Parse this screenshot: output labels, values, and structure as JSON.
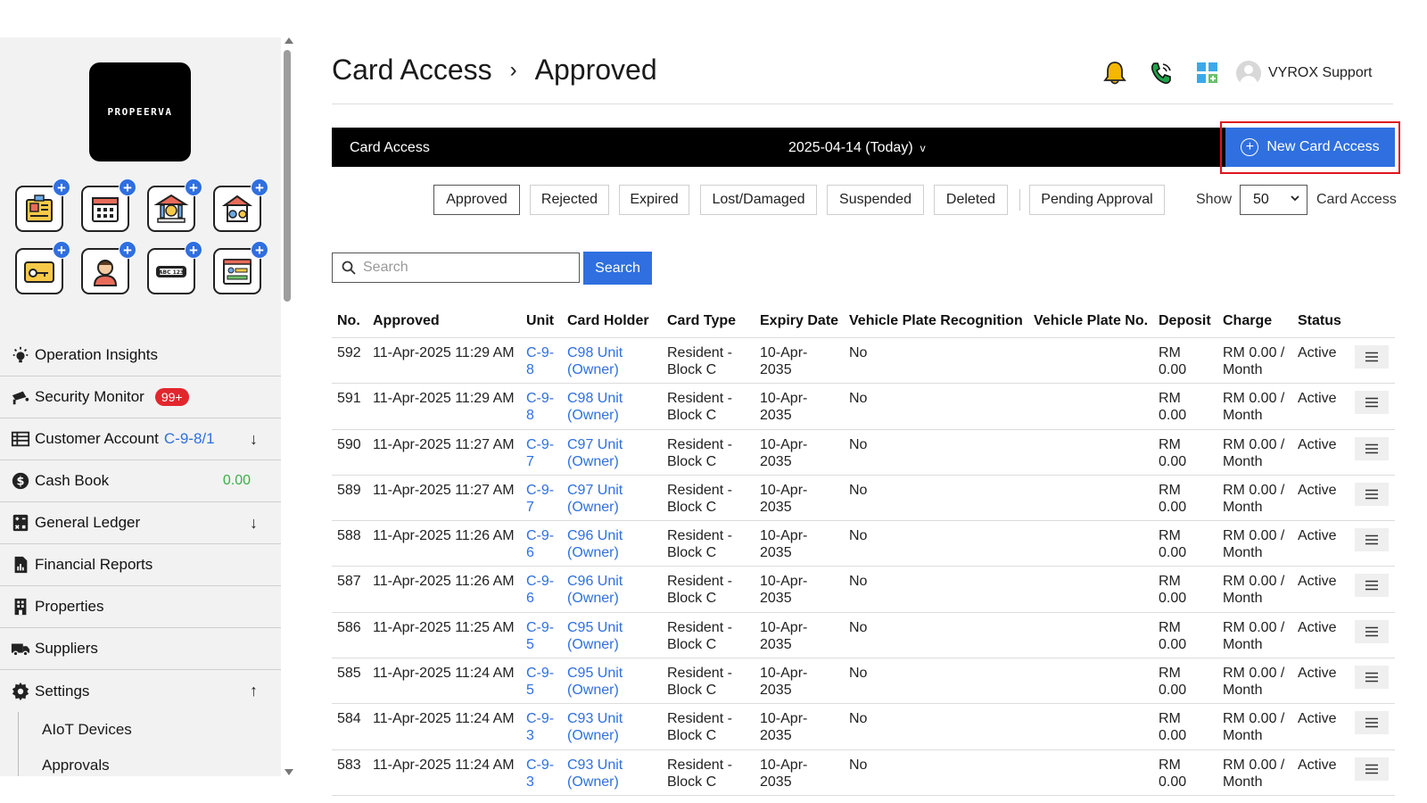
{
  "sidebar": {
    "logo_text": "PROPEERVA",
    "quick_actions": [
      {
        "icon": "resident-card-icon"
      },
      {
        "icon": "calendar-icon"
      },
      {
        "icon": "bank-icon"
      },
      {
        "icon": "facility-icon"
      },
      {
        "icon": "access-card-icon"
      },
      {
        "icon": "visitor-icon"
      },
      {
        "icon": "plate-number-icon"
      },
      {
        "icon": "login-screen-icon"
      }
    ],
    "nav": [
      {
        "label": "Operation Insights",
        "icon": "lightbulb-icon"
      },
      {
        "label": "Security Monitor",
        "icon": "security-camera-icon",
        "badge": "99+"
      },
      {
        "label": "Customer Account",
        "icon": "ledger-icon",
        "link": "C-9-8/1",
        "arrow": "↓"
      },
      {
        "label": "Cash Book",
        "icon": "dollar-icon",
        "value": "0.00"
      },
      {
        "label": "General Ledger",
        "icon": "calculator-icon",
        "arrow": "↓"
      },
      {
        "label": "Financial Reports",
        "icon": "report-icon"
      },
      {
        "label": "Properties",
        "icon": "building-icon"
      },
      {
        "label": "Suppliers",
        "icon": "truck-icon"
      },
      {
        "label": "Settings",
        "icon": "gear-icon",
        "arrow": "↑"
      }
    ],
    "sub_items": [
      "AIoT Devices",
      "Approvals"
    ]
  },
  "header": {
    "breadcrumb": [
      "Card Access",
      "Approved"
    ],
    "separator": "›",
    "user": "VYROX Support"
  },
  "toolbar": {
    "title": "Card Access",
    "date": "2025-04-14 (Today)",
    "date_caret": "v",
    "new_button": "New Card Access"
  },
  "filters": {
    "tabs": [
      "Approved",
      "Rejected",
      "Expired",
      "Lost/Damaged",
      "Suspended",
      "Deleted",
      "Pending Approval"
    ],
    "active": "Approved",
    "show_label": "Show",
    "show_value": "50",
    "show_suffix": "Card Access"
  },
  "search": {
    "placeholder": "Search",
    "button": "Search"
  },
  "table": {
    "columns": [
      "No.",
      "Approved",
      "Unit",
      "Card Holder",
      "Card Type",
      "Expiry Date",
      "Vehicle Plate Recognition",
      "Vehicle Plate No.",
      "Deposit",
      "Charge",
      "Status"
    ],
    "rows": [
      {
        "no": "592",
        "approved": "11-Apr-2025 11:29 AM",
        "unit_a": "C-9-",
        "unit_b": "8",
        "holder_a": "C98 Unit",
        "holder_b": "(Owner)",
        "type_a": "Resident -",
        "type_b": "Block C",
        "exp_a": "10-Apr-",
        "exp_b": "2035",
        "vpr": "No",
        "vpn": "",
        "dep_a": "RM",
        "dep_b": "0.00",
        "chg_a": "RM 0.00 /",
        "chg_b": "Month",
        "status": "Active"
      },
      {
        "no": "591",
        "approved": "11-Apr-2025 11:29 AM",
        "unit_a": "C-9-",
        "unit_b": "8",
        "holder_a": "C98 Unit",
        "holder_b": "(Owner)",
        "type_a": "Resident -",
        "type_b": "Block C",
        "exp_a": "10-Apr-",
        "exp_b": "2035",
        "vpr": "No",
        "vpn": "",
        "dep_a": "RM",
        "dep_b": "0.00",
        "chg_a": "RM 0.00 /",
        "chg_b": "Month",
        "status": "Active"
      },
      {
        "no": "590",
        "approved": "11-Apr-2025 11:27 AM",
        "unit_a": "C-9-",
        "unit_b": "7",
        "holder_a": "C97 Unit",
        "holder_b": "(Owner)",
        "type_a": "Resident -",
        "type_b": "Block C",
        "exp_a": "10-Apr-",
        "exp_b": "2035",
        "vpr": "No",
        "vpn": "",
        "dep_a": "RM",
        "dep_b": "0.00",
        "chg_a": "RM 0.00 /",
        "chg_b": "Month",
        "status": "Active"
      },
      {
        "no": "589",
        "approved": "11-Apr-2025 11:27 AM",
        "unit_a": "C-9-",
        "unit_b": "7",
        "holder_a": "C97 Unit",
        "holder_b": "(Owner)",
        "type_a": "Resident -",
        "type_b": "Block C",
        "exp_a": "10-Apr-",
        "exp_b": "2035",
        "vpr": "No",
        "vpn": "",
        "dep_a": "RM",
        "dep_b": "0.00",
        "chg_a": "RM 0.00 /",
        "chg_b": "Month",
        "status": "Active"
      },
      {
        "no": "588",
        "approved": "11-Apr-2025 11:26 AM",
        "unit_a": "C-9-",
        "unit_b": "6",
        "holder_a": "C96 Unit",
        "holder_b": "(Owner)",
        "type_a": "Resident -",
        "type_b": "Block C",
        "exp_a": "10-Apr-",
        "exp_b": "2035",
        "vpr": "No",
        "vpn": "",
        "dep_a": "RM",
        "dep_b": "0.00",
        "chg_a": "RM 0.00 /",
        "chg_b": "Month",
        "status": "Active"
      },
      {
        "no": "587",
        "approved": "11-Apr-2025 11:26 AM",
        "unit_a": "C-9-",
        "unit_b": "6",
        "holder_a": "C96 Unit",
        "holder_b": "(Owner)",
        "type_a": "Resident -",
        "type_b": "Block C",
        "exp_a": "10-Apr-",
        "exp_b": "2035",
        "vpr": "No",
        "vpn": "",
        "dep_a": "RM",
        "dep_b": "0.00",
        "chg_a": "RM 0.00 /",
        "chg_b": "Month",
        "status": "Active"
      },
      {
        "no": "586",
        "approved": "11-Apr-2025 11:25 AM",
        "unit_a": "C-9-",
        "unit_b": "5",
        "holder_a": "C95 Unit",
        "holder_b": "(Owner)",
        "type_a": "Resident -",
        "type_b": "Block C",
        "exp_a": "10-Apr-",
        "exp_b": "2035",
        "vpr": "No",
        "vpn": "",
        "dep_a": "RM",
        "dep_b": "0.00",
        "chg_a": "RM 0.00 /",
        "chg_b": "Month",
        "status": "Active"
      },
      {
        "no": "585",
        "approved": "11-Apr-2025 11:24 AM",
        "unit_a": "C-9-",
        "unit_b": "5",
        "holder_a": "C95 Unit",
        "holder_b": "(Owner)",
        "type_a": "Resident -",
        "type_b": "Block C",
        "exp_a": "10-Apr-",
        "exp_b": "2035",
        "vpr": "No",
        "vpn": "",
        "dep_a": "RM",
        "dep_b": "0.00",
        "chg_a": "RM 0.00 /",
        "chg_b": "Month",
        "status": "Active"
      },
      {
        "no": "584",
        "approved": "11-Apr-2025 11:24 AM",
        "unit_a": "C-9-",
        "unit_b": "3",
        "holder_a": "C93 Unit",
        "holder_b": "(Owner)",
        "type_a": "Resident -",
        "type_b": "Block C",
        "exp_a": "10-Apr-",
        "exp_b": "2035",
        "vpr": "No",
        "vpn": "",
        "dep_a": "RM",
        "dep_b": "0.00",
        "chg_a": "RM 0.00 /",
        "chg_b": "Month",
        "status": "Active"
      },
      {
        "no": "583",
        "approved": "11-Apr-2025 11:24 AM",
        "unit_a": "C-9-",
        "unit_b": "3",
        "holder_a": "C93 Unit",
        "holder_b": "(Owner)",
        "type_a": "Resident -",
        "type_b": "Block C",
        "exp_a": "10-Apr-",
        "exp_b": "2035",
        "vpr": "No",
        "vpn": "",
        "dep_a": "RM",
        "dep_b": "0.00",
        "chg_a": "RM 0.00 /",
        "chg_b": "Month",
        "status": "Active"
      }
    ]
  },
  "colors": {
    "accent": "#2f6fe0",
    "badge": "#e2262d",
    "highlight": "#e0141c",
    "cash_value": "#3fae4a",
    "toolbar_bg": "#000000"
  }
}
